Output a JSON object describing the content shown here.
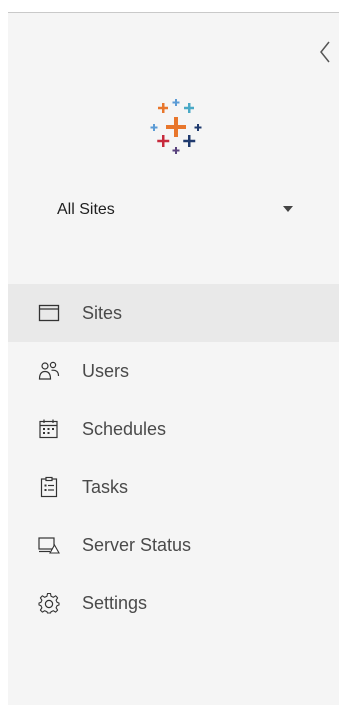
{
  "site_selector": {
    "label": "All Sites"
  },
  "icons": {
    "collapse": "chevron-left-icon",
    "logo": "tableau-logo",
    "dropdown": "caret-down-icon"
  },
  "colors": {
    "sidebar_bg": "#f5f5f5",
    "active_bg": "#e9e9e9",
    "text": "#4a4a4a",
    "logo_orange": "#e8762c",
    "logo_blue": "#1f3a6e",
    "logo_red": "#c72a3c",
    "logo_light_blue": "#5b9bd5",
    "logo_purple": "#59427d",
    "logo_teal": "#4aa9c6"
  },
  "nav": {
    "items": [
      {
        "label": "Sites",
        "icon": "window-icon",
        "active": true
      },
      {
        "label": "Users",
        "icon": "users-icon",
        "active": false
      },
      {
        "label": "Schedules",
        "icon": "calendar-icon",
        "active": false
      },
      {
        "label": "Tasks",
        "icon": "clipboard-list-icon",
        "active": false
      },
      {
        "label": "Server Status",
        "icon": "monitor-warning-icon",
        "active": false
      },
      {
        "label": "Settings",
        "icon": "gear-icon",
        "active": false
      }
    ]
  }
}
